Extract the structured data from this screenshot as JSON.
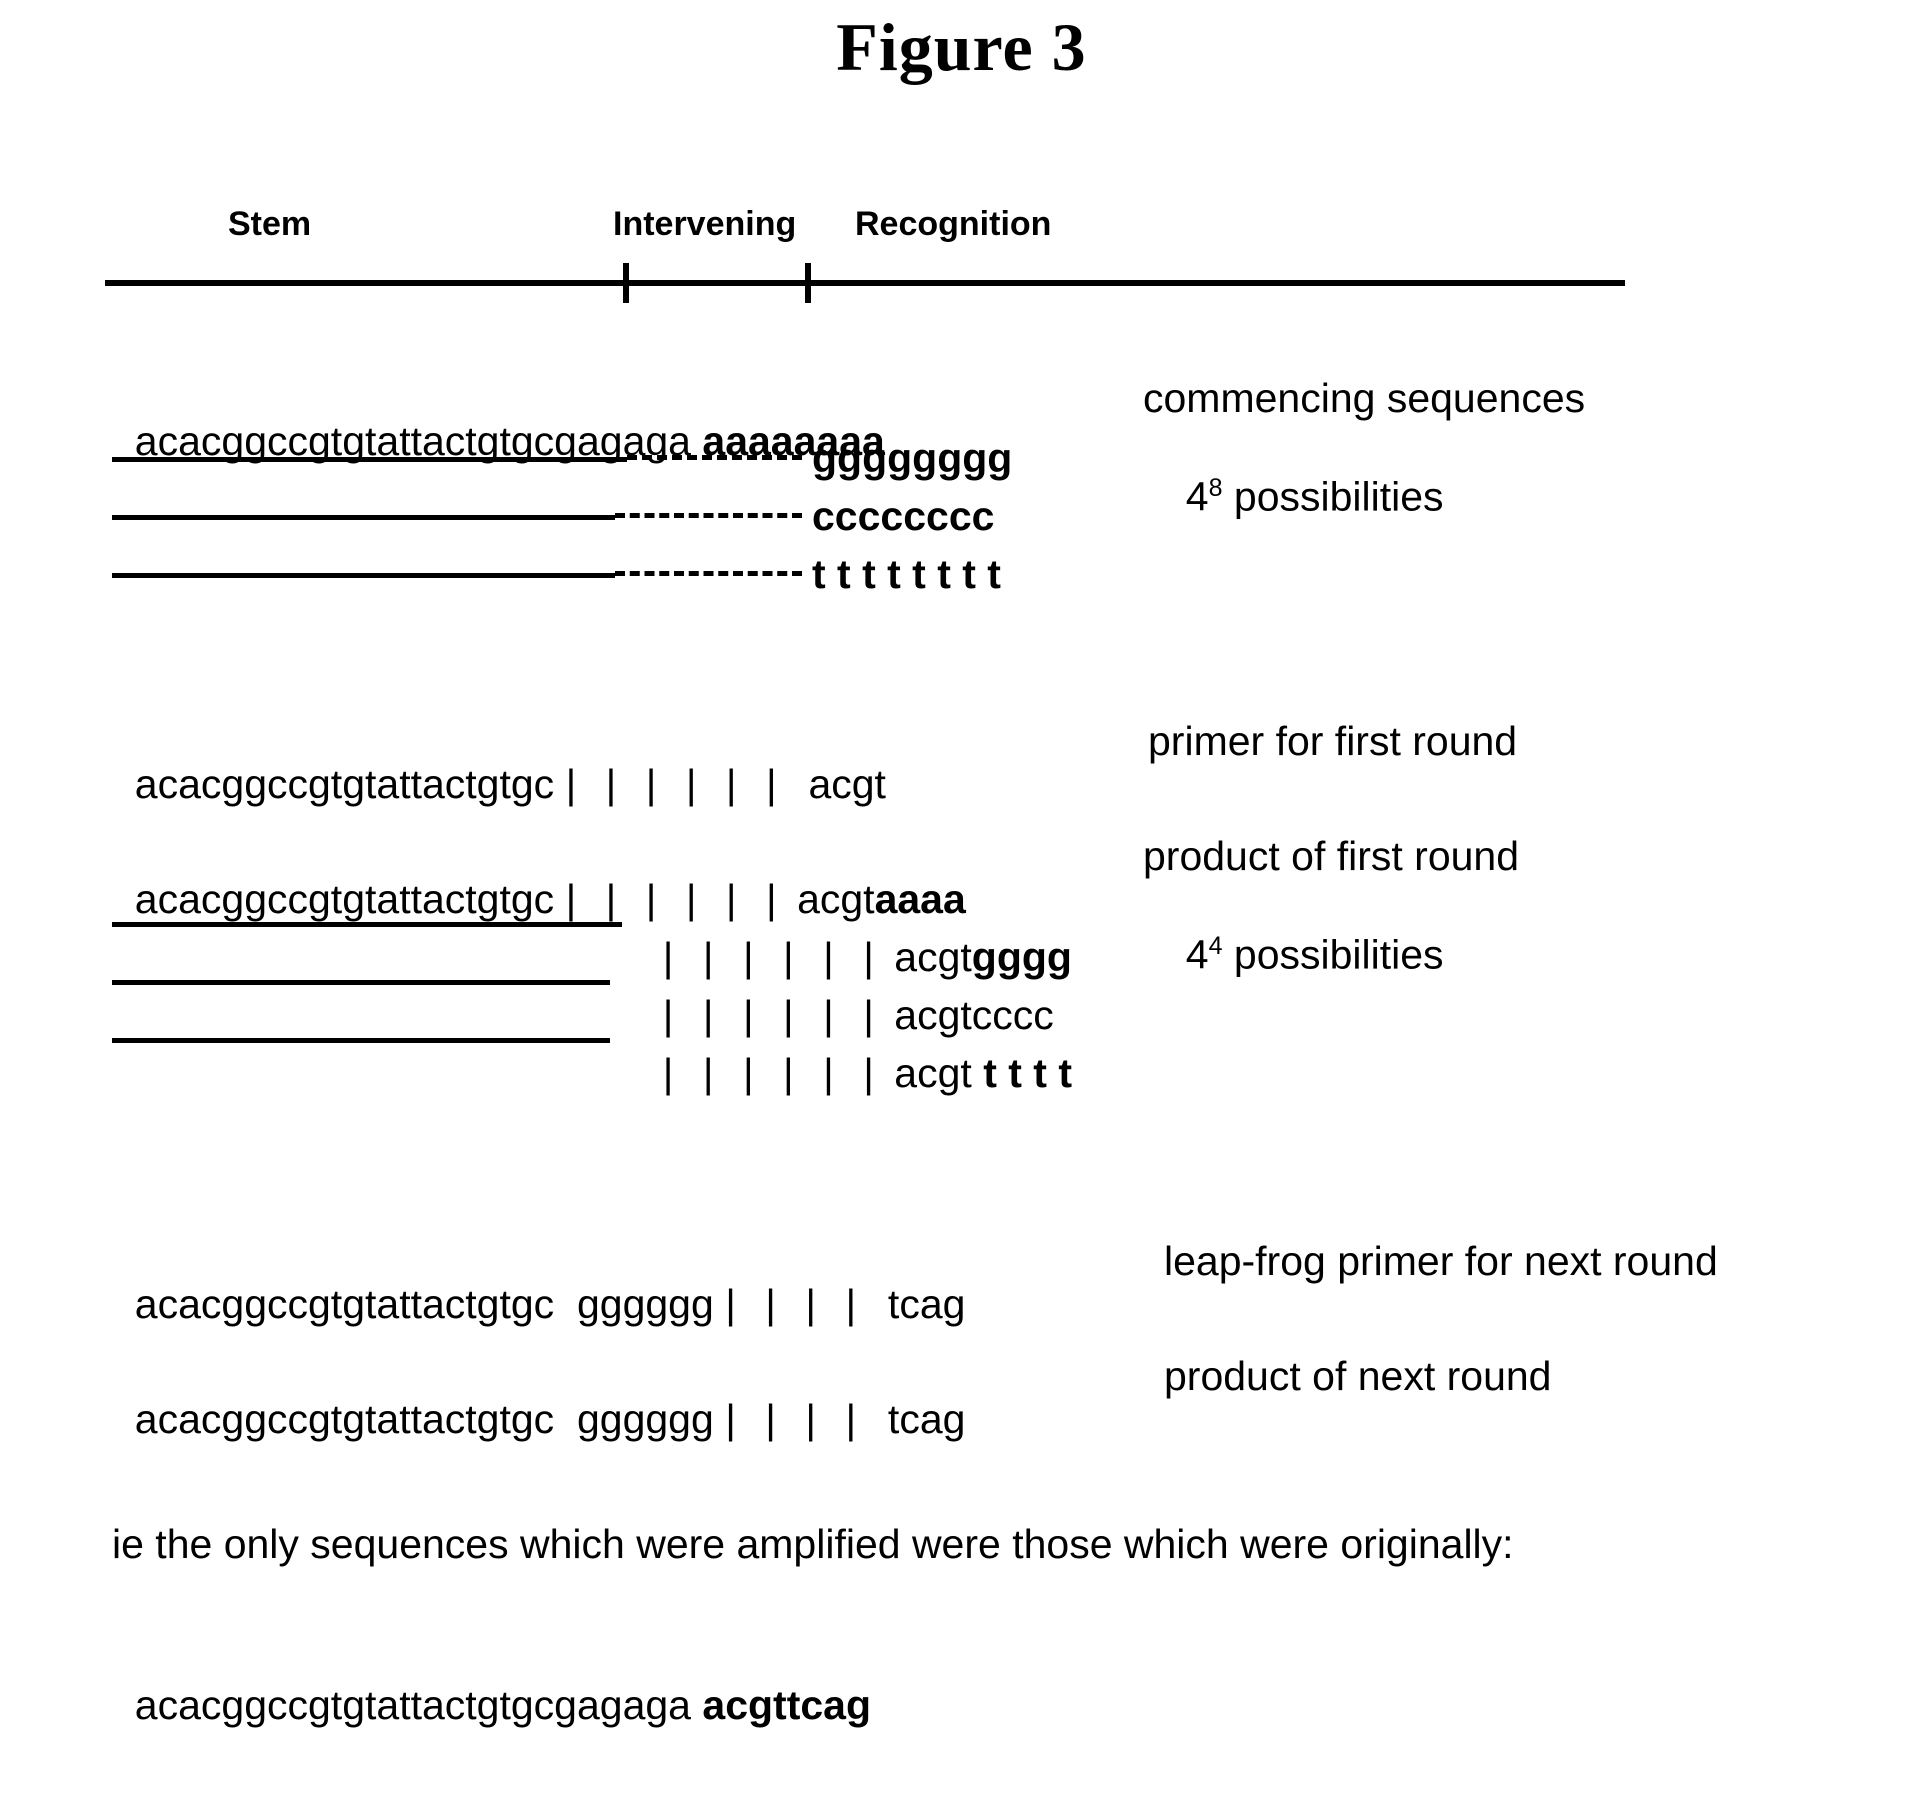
{
  "figure": {
    "title": "Figure 3"
  },
  "header": {
    "stem": "Stem",
    "intervening": "Intervening",
    "recognition": "Recognition"
  },
  "block_commencing": {
    "row1_left": "acacggccgtgtattactgtgcgagaga",
    "row1_bold": "aaaaaaaa",
    "row2_bold": "gggggggg",
    "row3_bold": "cccccccc",
    "row4_bold": "t t t t t t t t",
    "label_line1": "commencing sequences",
    "label_line2_base": "4",
    "label_line2_exp": "8",
    "label_line2_rest": " possibilities"
  },
  "block_primer_first": {
    "left": "acacggccgtgtattactgtgc",
    "bars": "| | | | | |",
    "tail": "acgt",
    "label": "primer for first round"
  },
  "block_product_first": {
    "row1_left": "acacggccgtgtattactgtgc",
    "row1_bars": "| | | | | |",
    "row1_tail": "acgt",
    "row1_bold": "aaaa",
    "row2_bars": "| | | | | |",
    "row2_tail": "acgt",
    "row2_bold": "gggg",
    "row3_bars": "| | | | | |",
    "row3_tail": "acgt",
    "row3_bold": "cccc",
    "row4_bars": "| | | | | |",
    "row4_tail": "acgt",
    "row4_bold": "t t t t",
    "label_line1": "product of first round",
    "label_line2_base": "4",
    "label_line2_exp": "4",
    "label_line2_rest": " possibilities"
  },
  "block_leapfrog": {
    "left": "acacggccgtgtattactgtgc",
    "gs": "gggggg",
    "bars": "| | | |",
    "tail": "tcag",
    "label": "leap-frog primer for next round"
  },
  "block_next_product": {
    "left": "acacggccgtgtattactgtgc",
    "gs": "gggggg",
    "bars": "| | | |",
    "tail": "tcag",
    "label": "product of next round"
  },
  "conclusion": {
    "sentence": "ie the only sequences which were amplified were those which were originally:",
    "final_left": "acacggccgtgtattactgtgcgagaga",
    "final_bold": "acgttcag"
  }
}
